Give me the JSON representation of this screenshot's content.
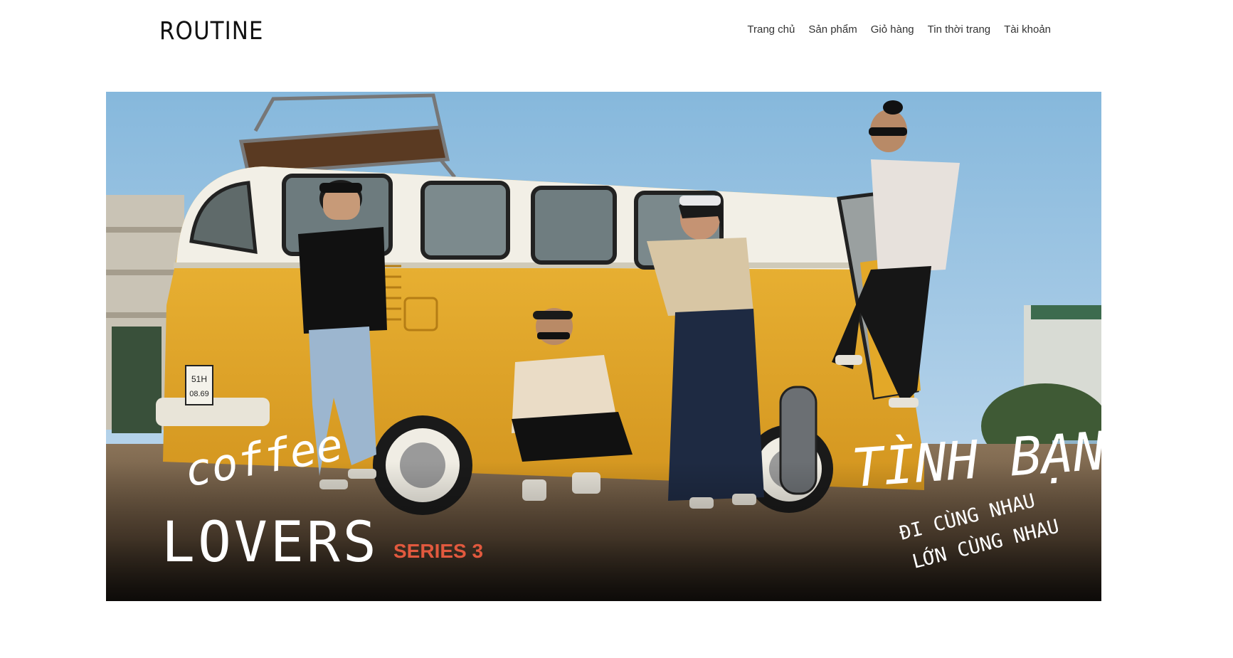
{
  "brand": {
    "logo_text": "ROUTINE"
  },
  "nav": {
    "items": [
      {
        "label": "Trang chủ"
      },
      {
        "label": "Sản phẩm"
      },
      {
        "label": "Giỏ hàng"
      },
      {
        "label": "Tin thời trang"
      },
      {
        "label": "Tài khoản"
      }
    ]
  },
  "banner": {
    "collection_line1": "coffee",
    "collection_line2": "LOVERS",
    "series": "SERIES 3",
    "theme_title": "TÌNH BẠN",
    "tagline_line1": "ĐI CÙNG NHAU",
    "tagline_line2": "LỚN CÙNG NHAU",
    "plate_line1": "51H",
    "plate_line2": "08.69",
    "colors": {
      "sky": "#a9cbe3",
      "van_yellow": "#e7ae2b",
      "van_white": "#f2efe6",
      "ground": "#6e5a44",
      "series_accent": "#e2593e"
    }
  }
}
